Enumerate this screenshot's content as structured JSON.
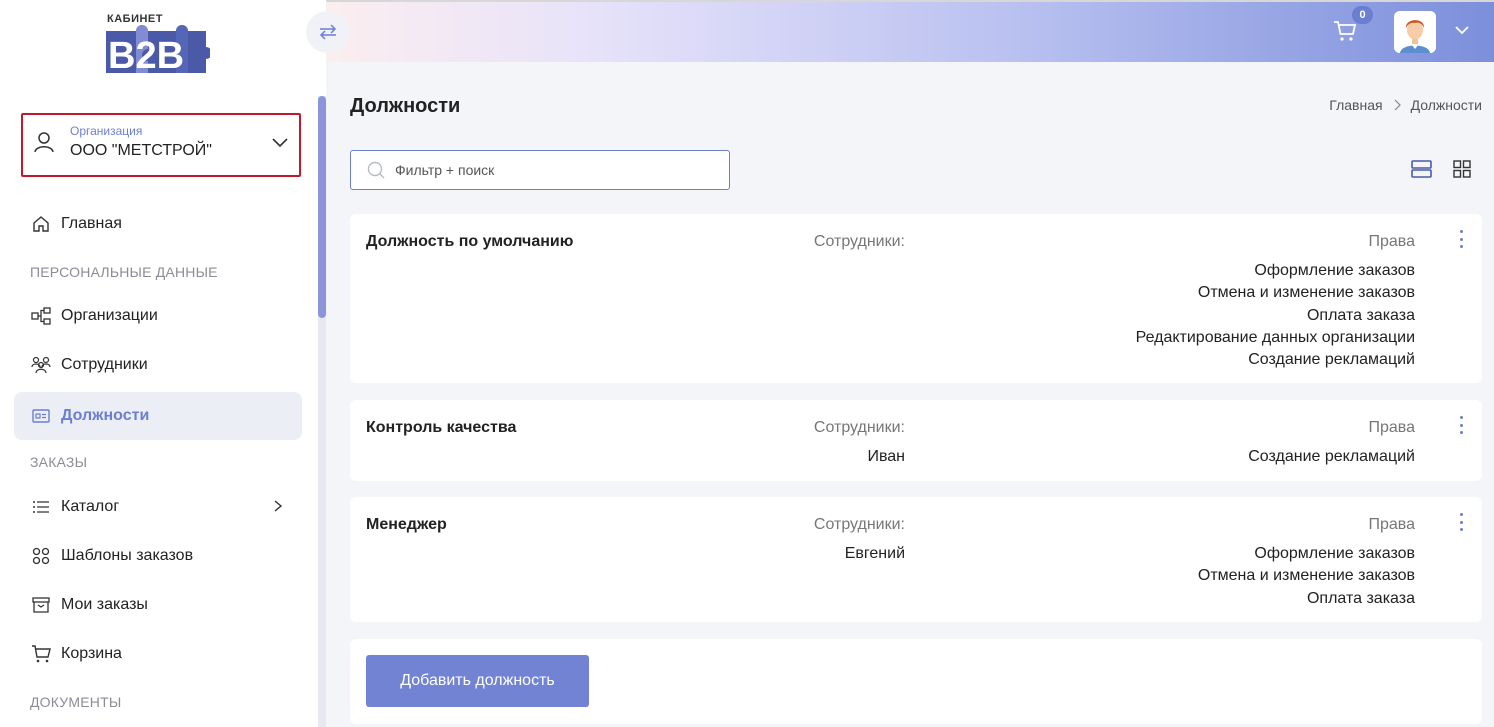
{
  "logo": {
    "caption": "КАБИНЕТ",
    "text": "B2B"
  },
  "org_selector": {
    "caption": "Организация",
    "value": "ООО \"МЕТСТРОЙ\""
  },
  "sidebar": {
    "home": "Главная",
    "section_personal": "ПЕРСОНАЛЬНЫЕ ДАННЫЕ",
    "organizations": "Организации",
    "employees": "Сотрудники",
    "positions": "Должности",
    "section_orders": "ЗАКАЗЫ",
    "catalog": "Каталог",
    "order_templates": "Шаблоны заказов",
    "my_orders": "Мои заказы",
    "cart": "Корзина",
    "section_documents": "ДОКУМЕНТЫ"
  },
  "header": {
    "cart_count": "0"
  },
  "page": {
    "title": "Должности",
    "breadcrumb": [
      "Главная",
      "Должности"
    ],
    "search_placeholder": "Фильтр + поиск"
  },
  "labels": {
    "employees": "Сотрудники:",
    "rights": "Права"
  },
  "positions": [
    {
      "name": "Должность по умолчанию",
      "employees": [],
      "rights": [
        "Оформление заказов",
        "Отмена и изменение заказов",
        "Оплата заказа",
        "Редактирование данных организации",
        "Создание рекламаций"
      ]
    },
    {
      "name": "Контроль качества",
      "employees": [
        "Иван"
      ],
      "rights": [
        "Создание рекламаций"
      ]
    },
    {
      "name": "Менеджер",
      "employees": [
        "Евгений"
      ],
      "rights": [
        "Оформление заказов",
        "Отмена и изменение заказов",
        "Оплата заказа"
      ]
    }
  ],
  "add_button": "Добавить должность",
  "colors": {
    "accent": "#6c7ecf",
    "highlight_border": "#c01a2c",
    "logo_blue": "#4a5aa8"
  }
}
